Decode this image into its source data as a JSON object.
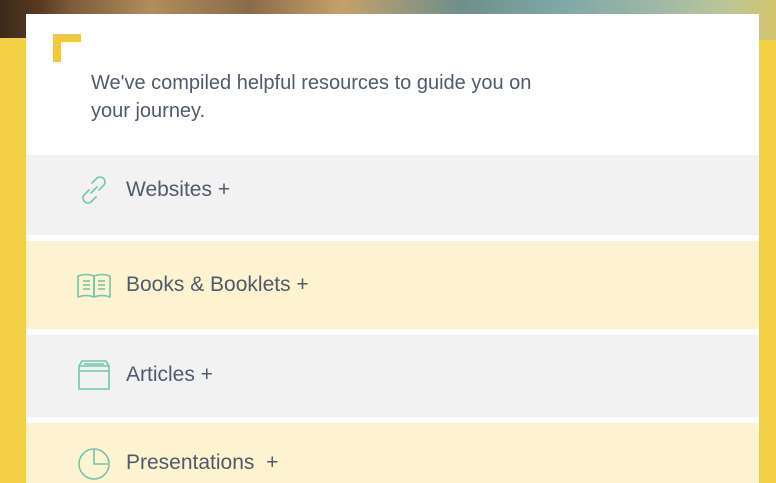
{
  "intro_text": "We've compiled helpful resources to guide you on your journey.",
  "colors": {
    "accent_yellow": "#f3c93b",
    "icon_green": "#6fc7ab",
    "text": "#4f5b6b",
    "row_gray": "#f2f2f2",
    "row_cream": "#fdf3d1"
  },
  "resources": [
    {
      "label": "Websites +",
      "icon": "link-icon"
    },
    {
      "label": "Books & Booklets +",
      "icon": "book-icon"
    },
    {
      "label": "Articles +",
      "icon": "folder-icon"
    },
    {
      "label": "Presentations  +",
      "icon": "pie-chart-icon"
    }
  ]
}
